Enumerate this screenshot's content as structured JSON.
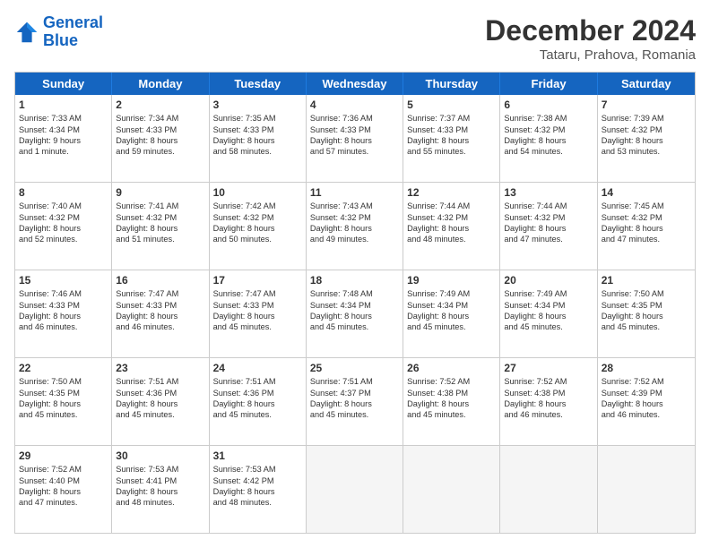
{
  "logo": {
    "text_general": "General",
    "text_blue": "Blue"
  },
  "header": {
    "title": "December 2024",
    "subtitle": "Tataru, Prahova, Romania"
  },
  "weekdays": [
    "Sunday",
    "Monday",
    "Tuesday",
    "Wednesday",
    "Thursday",
    "Friday",
    "Saturday"
  ],
  "rows": [
    [
      {
        "day": "1",
        "lines": [
          "Sunrise: 7:33 AM",
          "Sunset: 4:34 PM",
          "Daylight: 9 hours",
          "and 1 minute."
        ]
      },
      {
        "day": "2",
        "lines": [
          "Sunrise: 7:34 AM",
          "Sunset: 4:33 PM",
          "Daylight: 8 hours",
          "and 59 minutes."
        ]
      },
      {
        "day": "3",
        "lines": [
          "Sunrise: 7:35 AM",
          "Sunset: 4:33 PM",
          "Daylight: 8 hours",
          "and 58 minutes."
        ]
      },
      {
        "day": "4",
        "lines": [
          "Sunrise: 7:36 AM",
          "Sunset: 4:33 PM",
          "Daylight: 8 hours",
          "and 57 minutes."
        ]
      },
      {
        "day": "5",
        "lines": [
          "Sunrise: 7:37 AM",
          "Sunset: 4:33 PM",
          "Daylight: 8 hours",
          "and 55 minutes."
        ]
      },
      {
        "day": "6",
        "lines": [
          "Sunrise: 7:38 AM",
          "Sunset: 4:32 PM",
          "Daylight: 8 hours",
          "and 54 minutes."
        ]
      },
      {
        "day": "7",
        "lines": [
          "Sunrise: 7:39 AM",
          "Sunset: 4:32 PM",
          "Daylight: 8 hours",
          "and 53 minutes."
        ]
      }
    ],
    [
      {
        "day": "8",
        "lines": [
          "Sunrise: 7:40 AM",
          "Sunset: 4:32 PM",
          "Daylight: 8 hours",
          "and 52 minutes."
        ]
      },
      {
        "day": "9",
        "lines": [
          "Sunrise: 7:41 AM",
          "Sunset: 4:32 PM",
          "Daylight: 8 hours",
          "and 51 minutes."
        ]
      },
      {
        "day": "10",
        "lines": [
          "Sunrise: 7:42 AM",
          "Sunset: 4:32 PM",
          "Daylight: 8 hours",
          "and 50 minutes."
        ]
      },
      {
        "day": "11",
        "lines": [
          "Sunrise: 7:43 AM",
          "Sunset: 4:32 PM",
          "Daylight: 8 hours",
          "and 49 minutes."
        ]
      },
      {
        "day": "12",
        "lines": [
          "Sunrise: 7:44 AM",
          "Sunset: 4:32 PM",
          "Daylight: 8 hours",
          "and 48 minutes."
        ]
      },
      {
        "day": "13",
        "lines": [
          "Sunrise: 7:44 AM",
          "Sunset: 4:32 PM",
          "Daylight: 8 hours",
          "and 47 minutes."
        ]
      },
      {
        "day": "14",
        "lines": [
          "Sunrise: 7:45 AM",
          "Sunset: 4:32 PM",
          "Daylight: 8 hours",
          "and 47 minutes."
        ]
      }
    ],
    [
      {
        "day": "15",
        "lines": [
          "Sunrise: 7:46 AM",
          "Sunset: 4:33 PM",
          "Daylight: 8 hours",
          "and 46 minutes."
        ]
      },
      {
        "day": "16",
        "lines": [
          "Sunrise: 7:47 AM",
          "Sunset: 4:33 PM",
          "Daylight: 8 hours",
          "and 46 minutes."
        ]
      },
      {
        "day": "17",
        "lines": [
          "Sunrise: 7:47 AM",
          "Sunset: 4:33 PM",
          "Daylight: 8 hours",
          "and 45 minutes."
        ]
      },
      {
        "day": "18",
        "lines": [
          "Sunrise: 7:48 AM",
          "Sunset: 4:34 PM",
          "Daylight: 8 hours",
          "and 45 minutes."
        ]
      },
      {
        "day": "19",
        "lines": [
          "Sunrise: 7:49 AM",
          "Sunset: 4:34 PM",
          "Daylight: 8 hours",
          "and 45 minutes."
        ]
      },
      {
        "day": "20",
        "lines": [
          "Sunrise: 7:49 AM",
          "Sunset: 4:34 PM",
          "Daylight: 8 hours",
          "and 45 minutes."
        ]
      },
      {
        "day": "21",
        "lines": [
          "Sunrise: 7:50 AM",
          "Sunset: 4:35 PM",
          "Daylight: 8 hours",
          "and 45 minutes."
        ]
      }
    ],
    [
      {
        "day": "22",
        "lines": [
          "Sunrise: 7:50 AM",
          "Sunset: 4:35 PM",
          "Daylight: 8 hours",
          "and 45 minutes."
        ]
      },
      {
        "day": "23",
        "lines": [
          "Sunrise: 7:51 AM",
          "Sunset: 4:36 PM",
          "Daylight: 8 hours",
          "and 45 minutes."
        ]
      },
      {
        "day": "24",
        "lines": [
          "Sunrise: 7:51 AM",
          "Sunset: 4:36 PM",
          "Daylight: 8 hours",
          "and 45 minutes."
        ]
      },
      {
        "day": "25",
        "lines": [
          "Sunrise: 7:51 AM",
          "Sunset: 4:37 PM",
          "Daylight: 8 hours",
          "and 45 minutes."
        ]
      },
      {
        "day": "26",
        "lines": [
          "Sunrise: 7:52 AM",
          "Sunset: 4:38 PM",
          "Daylight: 8 hours",
          "and 45 minutes."
        ]
      },
      {
        "day": "27",
        "lines": [
          "Sunrise: 7:52 AM",
          "Sunset: 4:38 PM",
          "Daylight: 8 hours",
          "and 46 minutes."
        ]
      },
      {
        "day": "28",
        "lines": [
          "Sunrise: 7:52 AM",
          "Sunset: 4:39 PM",
          "Daylight: 8 hours",
          "and 46 minutes."
        ]
      }
    ],
    [
      {
        "day": "29",
        "lines": [
          "Sunrise: 7:52 AM",
          "Sunset: 4:40 PM",
          "Daylight: 8 hours",
          "and 47 minutes."
        ]
      },
      {
        "day": "30",
        "lines": [
          "Sunrise: 7:53 AM",
          "Sunset: 4:41 PM",
          "Daylight: 8 hours",
          "and 48 minutes."
        ]
      },
      {
        "day": "31",
        "lines": [
          "Sunrise: 7:53 AM",
          "Sunset: 4:42 PM",
          "Daylight: 8 hours",
          "and 48 minutes."
        ]
      },
      {
        "day": "",
        "lines": []
      },
      {
        "day": "",
        "lines": []
      },
      {
        "day": "",
        "lines": []
      },
      {
        "day": "",
        "lines": []
      }
    ]
  ]
}
